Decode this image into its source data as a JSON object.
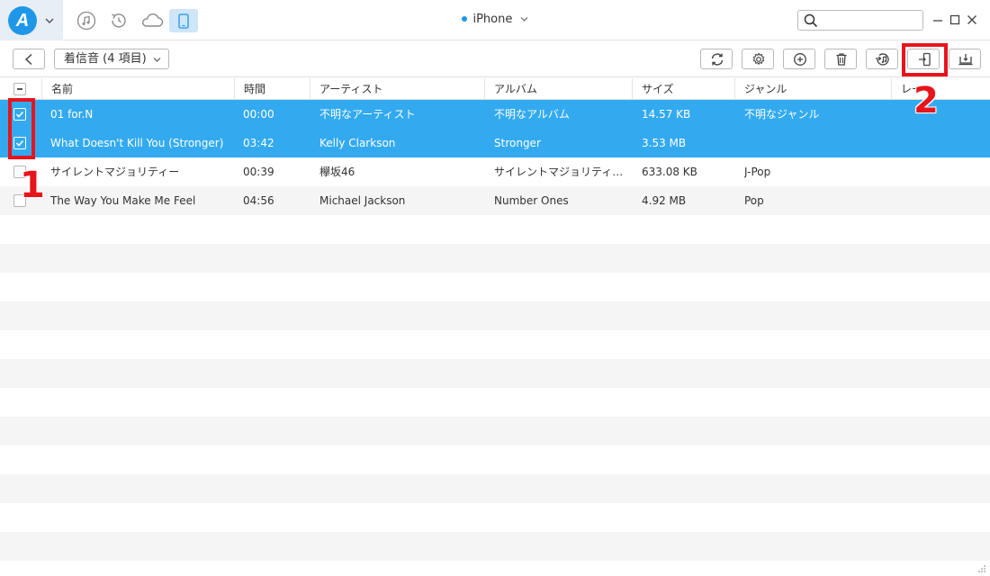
{
  "app": {
    "logo_letter": "A",
    "device_name": "iPhone",
    "search_placeholder": "",
    "accent": "#1f97e9",
    "selection_color": "#33aaf0"
  },
  "top_icons": [
    "music-note-icon",
    "history-icon",
    "cloud-icon",
    "phone-icon"
  ],
  "toolbar": {
    "category_label": "着信音 (4 項目)",
    "buttons": [
      "refresh-icon",
      "settings-icon",
      "add-icon",
      "delete-icon",
      "to-itunes-icon",
      "to-device-icon",
      "to-computer-icon"
    ]
  },
  "table": {
    "columns": [
      "名前",
      "時間",
      "アーティスト",
      "アルバム",
      "サイズ",
      "ジャンル",
      "レー"
    ],
    "rows": [
      {
        "selected": true,
        "name": "01 for.N",
        "time": "00:00",
        "artist": "不明なアーティスト",
        "album": "不明なアルバム",
        "size": "14.57 KB",
        "genre": "不明なジャンル"
      },
      {
        "selected": true,
        "name": "What Doesn't Kill You (Stronger)",
        "time": "03:42",
        "artist": "Kelly Clarkson",
        "album": "Stronger",
        "size": "3.53 MB",
        "genre": ""
      },
      {
        "selected": false,
        "name": "サイレントマジョリティー",
        "time": "00:39",
        "artist": "欅坂46",
        "album": "サイレントマジョリティー (Spec...",
        "size": "633.08 KB",
        "genre": "J-Pop"
      },
      {
        "selected": false,
        "name": "The Way You Make Me Feel",
        "time": "04:56",
        "artist": "Michael Jackson",
        "album": "Number Ones",
        "size": "4.92 MB",
        "genre": "Pop"
      }
    ]
  },
  "annotations": {
    "step1": "1",
    "step2": "2",
    "color": "#e8141b"
  }
}
